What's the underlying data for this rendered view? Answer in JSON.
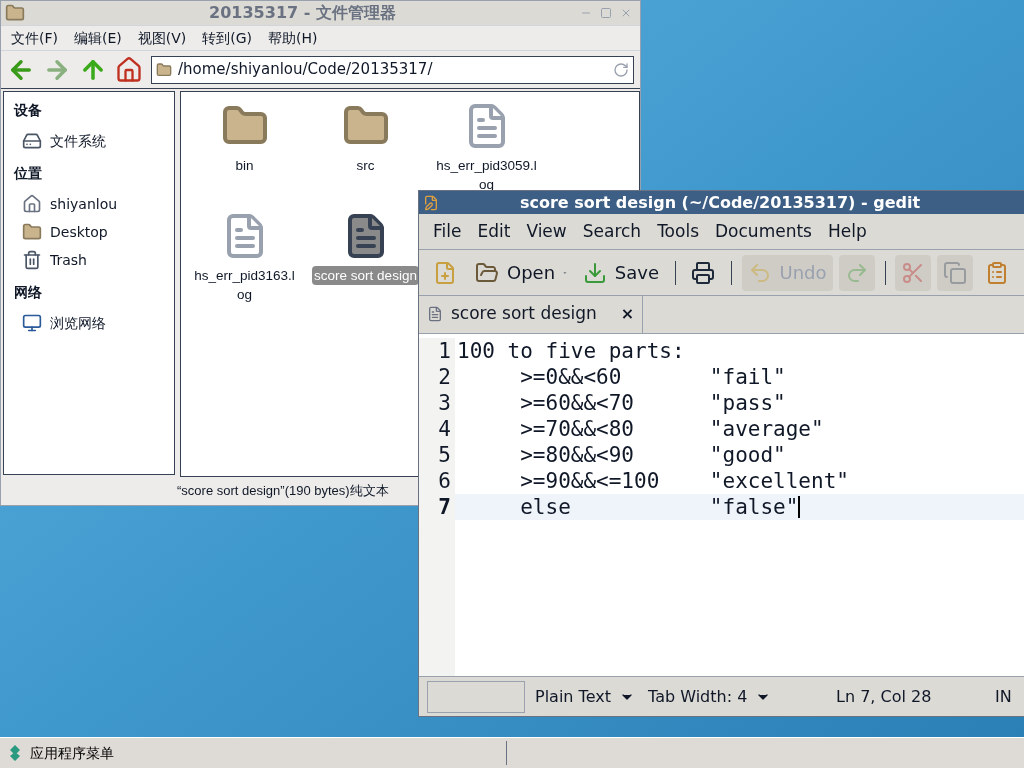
{
  "file_manager": {
    "title": "20135317 - 文件管理器",
    "menu": [
      "文件(F)",
      "编辑(E)",
      "视图(V)",
      "转到(G)",
      "帮助(H)"
    ],
    "path": "/home/shiyanlou/Code/20135317/",
    "sidebar": [
      {
        "heading": "设备",
        "items": [
          {
            "label": "文件系统",
            "kind": "drive"
          }
        ]
      },
      {
        "heading": "位置",
        "items": [
          {
            "label": "shiyanlou",
            "kind": "home"
          },
          {
            "label": "Desktop",
            "kind": "desktop"
          },
          {
            "label": "Trash",
            "kind": "trash"
          }
        ]
      },
      {
        "heading": "网络",
        "items": [
          {
            "label": "浏览网络",
            "kind": "network"
          }
        ]
      }
    ],
    "files": [
      {
        "name": "bin",
        "kind": "folder",
        "selected": false
      },
      {
        "name": "src",
        "kind": "folder",
        "selected": false
      },
      {
        "name": "hs_err_pid3059.log",
        "kind": "text",
        "selected": false
      },
      {
        "name": "hs_err_pid3163.log",
        "kind": "text",
        "selected": false
      },
      {
        "name": "score sort design",
        "kind": "text",
        "selected": true
      }
    ],
    "status": "“score sort design”(190 bytes)纯文本"
  },
  "gedit": {
    "title": "score sort design (~/Code/20135317) - gedit",
    "menu": [
      "File",
      "Edit",
      "View",
      "Search",
      "Tools",
      "Documents",
      "Help"
    ],
    "toolbar": [
      {
        "kind": "new",
        "disabled": false
      },
      {
        "kind": "open",
        "label": "Open",
        "disabled": false
      },
      {
        "kind": "save",
        "label": "Save",
        "disabled": false
      },
      {
        "kind": "print",
        "disabled": false
      },
      {
        "kind": "undo",
        "label": "Undo",
        "disabled": true
      },
      {
        "kind": "redo",
        "disabled": true
      },
      {
        "kind": "cut",
        "disabled": true
      },
      {
        "kind": "copy",
        "disabled": true
      },
      {
        "kind": "paste",
        "disabled": false
      }
    ],
    "tab": {
      "label": "score sort design",
      "close": "×"
    },
    "lines": [
      {
        "number": "1",
        "text": "100 to five parts:",
        "current": false
      },
      {
        "number": "2",
        "text": "     >=0&&<60       \"fail\"",
        "current": false
      },
      {
        "number": "3",
        "text": "     >=60&&<70      \"pass\"",
        "current": false
      },
      {
        "number": "4",
        "text": "     >=70&&<80      \"average\"",
        "current": false
      },
      {
        "number": "5",
        "text": "     >=80&&<90      \"good\"",
        "current": false
      },
      {
        "number": "6",
        "text": "     >=90&&<=100    \"excellent\"",
        "current": false
      },
      {
        "number": "7",
        "text": "     else           \"false\"",
        "current": true
      }
    ],
    "status": {
      "language": "Plain Text",
      "tab_width": "Tab Width: 4",
      "position": "Ln 7, Col 28",
      "mode": "IN"
    }
  },
  "taskbar": {
    "menu": "应用程序菜单"
  }
}
